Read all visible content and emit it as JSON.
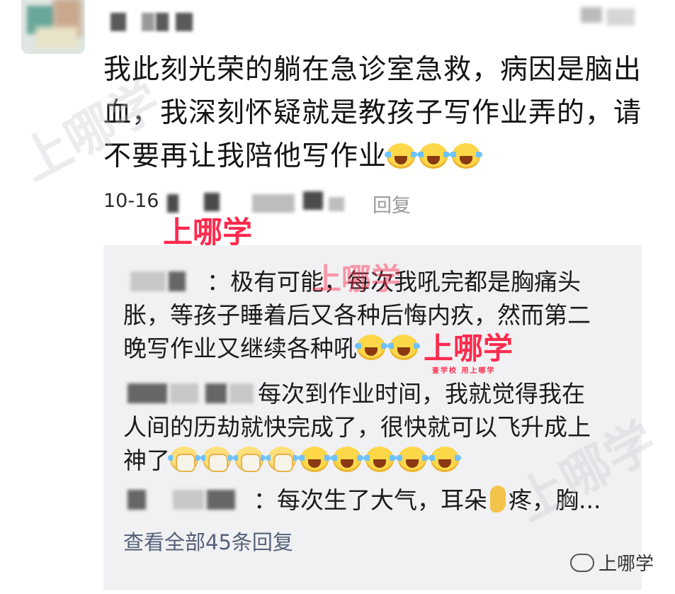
{
  "post": {
    "text_lines": [
      "我此刻光荣的躺在急诊室急救，病因是脑出",
      "血，我深刻怀疑就是教孩子写作业弄的，请",
      "不要再让我陪他写作业"
    ],
    "emojis_after_text": [
      "laugh-cry-icon",
      "laugh-cry-icon",
      "laugh-cry-icon"
    ],
    "time_prefix": "10-16",
    "reply_suffix": "回复"
  },
  "replies": [
    {
      "text_lines": [
        "：极有可能，每次我吼完都是胸痛头",
        "胀，等孩子睡着后又各种后悔内疚，然而第二",
        "晚写作业又继续各种吼"
      ]
    },
    {
      "text_lines": [
        "每次到作业时间，我就觉得我在",
        "人间的历劫就快完成了，很快就可以飞升成上",
        "神了"
      ]
    },
    {
      "text_a": "：每次生了大气，耳朵",
      "text_b": "疼，胸..."
    }
  ],
  "view_all": "查看全部45条回复",
  "watermark": {
    "title": "上哪学",
    "subtitle": "查学校  用上哪学"
  },
  "brand": "上哪学",
  "colors": {
    "accent_red": "#ff2b4e",
    "reply_bg": "#f1f1f3",
    "link_blue_gray": "#55617a"
  }
}
